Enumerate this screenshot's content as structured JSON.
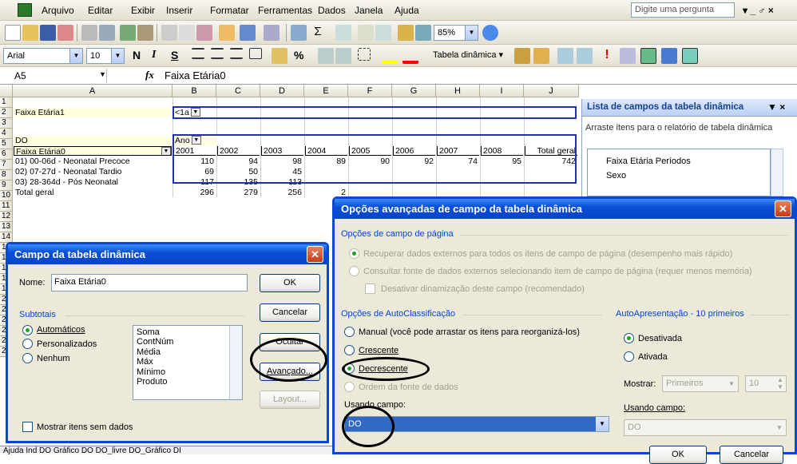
{
  "menu": {
    "items": [
      "Arquivo",
      "Editar",
      "Exibir",
      "Inserir",
      "Formatar",
      "Ferramentas",
      "Dados",
      "Janela",
      "Ajuda"
    ],
    "help_placeholder": "Digite uma pergunta",
    "window_controls": "▾ _ ♂ ×"
  },
  "standard_toolbar": {
    "zoom": "85%"
  },
  "format_toolbar": {
    "font": "Arial",
    "size": "10",
    "bold": "N",
    "italic": "I",
    "underline": "S",
    "percent": "%",
    "pivot_menu": "Tabela dinâmica ▾"
  },
  "formula_bar": {
    "namebox": "A5",
    "fx": "fx",
    "value": "Faixa Etária0"
  },
  "columns": [
    "A",
    "B",
    "C",
    "D",
    "E",
    "F",
    "G",
    "H",
    "I",
    "J"
  ],
  "rows": [
    "1",
    "2",
    "3",
    "4",
    "5",
    "6",
    "7",
    "8",
    "9",
    "10",
    "11",
    "12",
    "13",
    "14",
    "15",
    "16",
    "17",
    "18",
    "19",
    "20",
    "21",
    "22",
    "23",
    "24",
    "25"
  ],
  "sheet": {
    "page_field_label": "Faixa Etária1",
    "page_field_value": "<1a",
    "data_label": "DO",
    "col_field": "Ano",
    "row_field": "Faixa Etária0",
    "years": [
      "2001",
      "2002",
      "2003",
      "2004",
      "2005",
      "2006",
      "2007",
      "2008",
      "Total geral"
    ],
    "table": [
      {
        "label": "01) 00-06d - Neonatal Precoce",
        "values": [
          "110",
          "94",
          "98",
          "89",
          "90",
          "92",
          "74",
          "95",
          "742"
        ]
      },
      {
        "label": "02) 07-27d - Neonatal Tardio",
        "values": [
          "69",
          "50",
          "45",
          "",
          "",
          "",
          "",
          "",
          ""
        ]
      },
      {
        "label": "03) 28-364d - Pós Neonatal",
        "values": [
          "117",
          "135",
          "113",
          "",
          "",
          "",
          "",
          "",
          ""
        ]
      },
      {
        "label": "Total geral",
        "values": [
          "296",
          "279",
          "256",
          "2",
          "",
          "",
          "",
          "",
          ""
        ]
      }
    ]
  },
  "sheet_tabs": "Ajuda  Ind  DO  Gráfico DO  DO_livre  DO_Gráfico  DI",
  "task_pane": {
    "title": "Lista de campos da tabela dinâmica",
    "hint": "Arraste itens para o relatório de tabela dinâmica",
    "fields": [
      "Faixa Etária Períodos",
      "Sexo"
    ]
  },
  "field_dialog": {
    "title": "Campo da tabela dinâmica",
    "name_label": "Nome:",
    "name_value": "Faixa Etária0",
    "subtotals_label": "Subtotais",
    "opt_auto": "Automáticos",
    "opt_custom": "Personalizados",
    "opt_none": "Nenhum",
    "functions": [
      "Soma",
      "ContNúm",
      "Média",
      "Máx",
      "Mínimo",
      "Produto"
    ],
    "ok": "OK",
    "cancel": "Cancelar",
    "hide": "Ocultar",
    "advanced": "Avançado...",
    "layout": "Layout...",
    "show_empty": "Mostrar itens sem dados"
  },
  "adv_dialog": {
    "title": "Opções avançadas de campo da tabela dinâmica",
    "page_opts": "Opções de campo de página",
    "page_opt1": "Recuperar dados externos para todos os itens de campo de página (desempenho mais rápido)",
    "page_opt2": "Consultar fonte de dados externos selecionando item de campo de página (requer menos memória)",
    "page_chk": "Desativar dinamização deste campo (recomendado)",
    "autosort": "Opções de AutoClassificação",
    "sort_manual": "Manual (você pode arrastar os itens para reorganizá-los)",
    "sort_asc": "Crescente",
    "sort_desc": "Decrescente",
    "sort_source": "Ordem da fonte de dados",
    "using_field": "Usando campo:",
    "using_field_value": "DO",
    "autoshow": "AutoApresentação - 10 primeiros",
    "show_off": "Desativada",
    "show_on": "Ativada",
    "show_label": "Mostrar:",
    "show_value": "Primeiros",
    "show_count": "10",
    "using_field2": "Usando campo:",
    "using_field2_value": "DO",
    "ok": "OK",
    "cancel": "Cancelar"
  }
}
